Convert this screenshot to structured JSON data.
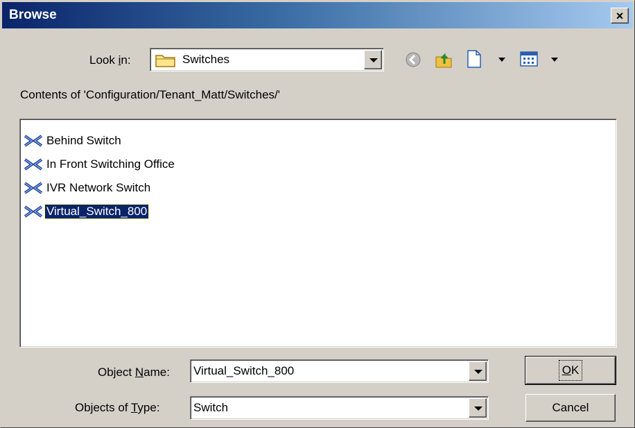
{
  "window": {
    "title": "Browse",
    "close_label": "×"
  },
  "look_in": {
    "label_pre": "Look ",
    "label_hotkey": "i",
    "label_post": "n:",
    "value": "Switches"
  },
  "toolbar": {
    "icons": [
      "back-icon",
      "up-folder-icon",
      "new-folder-icon",
      "view-menu-icon"
    ]
  },
  "contents_label": "Contents of 'Configuration/Tenant_Matt/Switches/'",
  "items": [
    {
      "label": "Behind Switch",
      "selected": false
    },
    {
      "label": "In Front Switching Office",
      "selected": false
    },
    {
      "label": "IVR Network Switch",
      "selected": false
    },
    {
      "label": "Virtual_Switch_800",
      "selected": true
    }
  ],
  "object_name": {
    "label_pre": "Object ",
    "label_hotkey": "N",
    "label_post": "ame:",
    "value": "Virtual_Switch_800"
  },
  "object_type": {
    "label_pre": "Objects of ",
    "label_hotkey": "T",
    "label_post": "ype:",
    "value": "Switch"
  },
  "buttons": {
    "ok_hotkey": "O",
    "ok_rest": "K",
    "cancel": "Cancel"
  },
  "colors": {
    "title_start": "#0a246a",
    "title_end": "#a6caf0",
    "face": "#d4d0c8",
    "selection": "#0a246a",
    "switch_icon": "#1b3a8c"
  }
}
